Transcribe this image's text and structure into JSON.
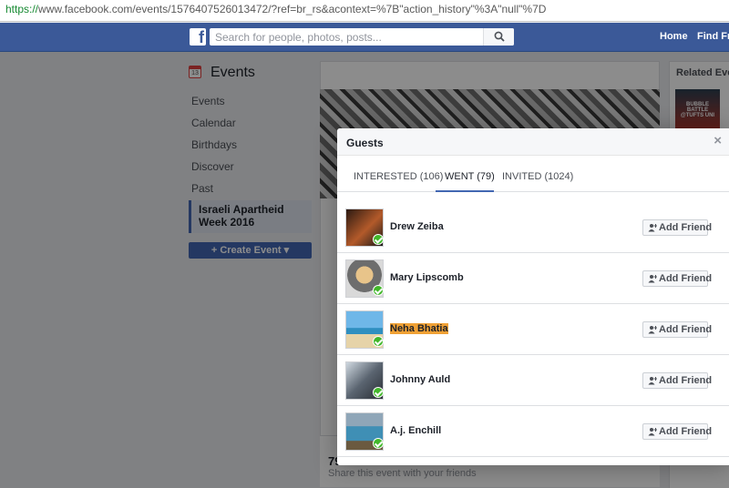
{
  "browser": {
    "url_scheme": "https://",
    "url_rest": "www.facebook.com/events/1576407526013472/?ref=br_rs&acontext=%7B\"action_history\"%3A\"null\"%7D"
  },
  "header": {
    "logo": "f",
    "search_placeholder": "Search for people, photos, posts...",
    "nav": [
      "Home",
      "Find Frien"
    ]
  },
  "sidebar": {
    "title": "Events",
    "calendar_day": "13",
    "items": [
      "Events",
      "Calendar",
      "Birthdays",
      "Discover",
      "Past"
    ],
    "active_event": "Israeli Apartheid Week 2016",
    "create_button": "+ Create Event ▾"
  },
  "event": {
    "count": "79",
    "share_text": "Share this event with your friends"
  },
  "related": {
    "title": "Related Events",
    "thumb_text": "BUBBLE BATTLE @TUFTS UNI"
  },
  "dialog": {
    "title": "Guests",
    "close": "×",
    "tabs": [
      "INTERESTED (106)",
      "WENT (79)",
      "INVITED (1024)"
    ],
    "active_tab": 1,
    "guests": [
      {
        "name": "Drew Zeiba",
        "button": "Add Friend",
        "highlighted": false
      },
      {
        "name": "Mary Lipscomb",
        "button": "Add Friend",
        "highlighted": false
      },
      {
        "name": "Neha Bhatia",
        "button": "Add Friend",
        "highlighted": true
      },
      {
        "name": "Johnny Auld",
        "button": "Add Friend",
        "highlighted": false
      },
      {
        "name": "A.j. Enchill",
        "button": "Add Friend",
        "highlighted": false
      }
    ]
  },
  "colors": {
    "brand": "#3b5998",
    "accent": "#4267b2",
    "check": "#42b72a",
    "highlight": "#f0a135"
  }
}
